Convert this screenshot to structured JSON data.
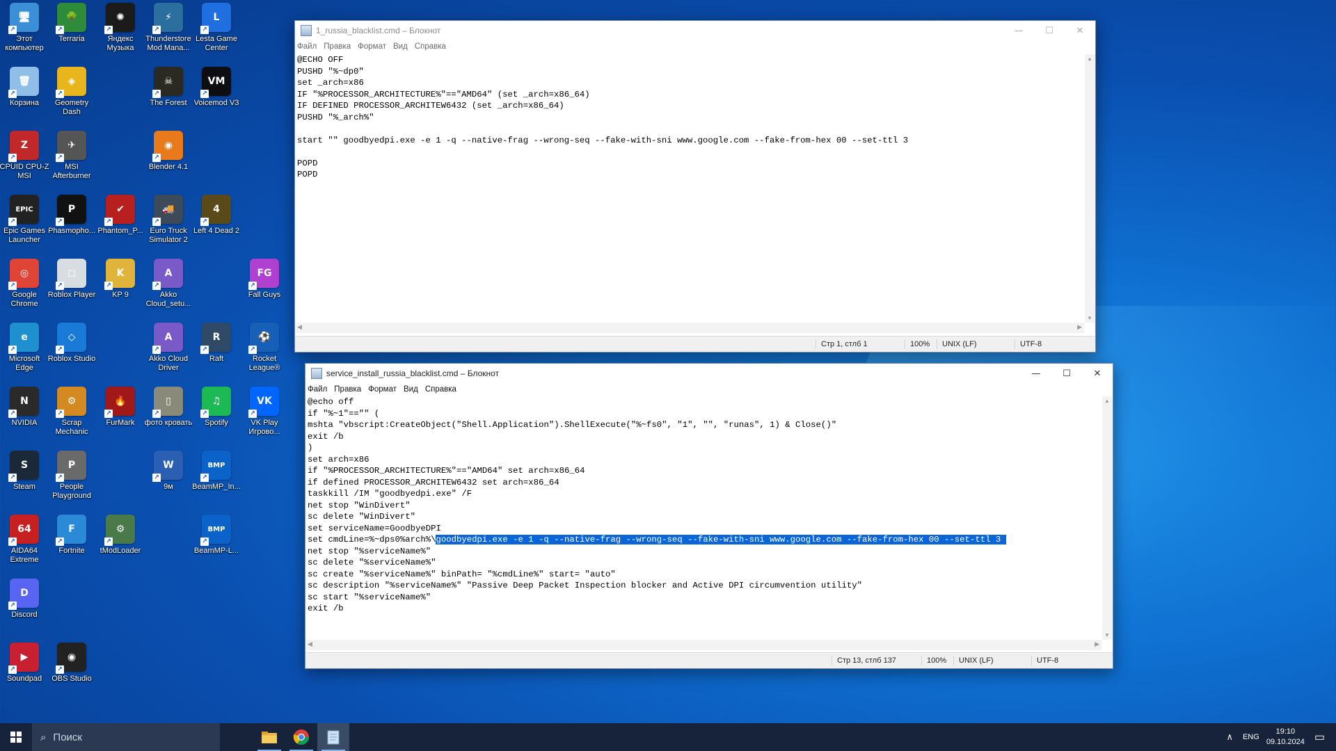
{
  "desktop": {
    "icons": [
      {
        "label": "Этот компьютер",
        "glyph": "🖥",
        "bg": "#3a8fd6"
      },
      {
        "label": "Terraria",
        "glyph": "🌳",
        "bg": "#2e8b3a"
      },
      {
        "label": "Яндекс Музыка",
        "glyph": "✺",
        "bg": "#1b1b1b"
      },
      {
        "label": "Thunderstore Mod Mana...",
        "glyph": "⚡",
        "bg": "#2b6f9e"
      },
      {
        "label": "Lesta Game Center",
        "glyph": "L",
        "bg": "#1f6fe0"
      },
      {
        "label": "Корзина",
        "glyph": "🗑",
        "bg": "#8fbfe8"
      },
      {
        "label": "Geometry Dash",
        "glyph": "◈",
        "bg": "#e8b51c"
      },
      {
        "label": "The Forest",
        "glyph": "☠",
        "bg": "#2a2a22"
      },
      {
        "label": "Voicemod V3",
        "glyph": "VM",
        "bg": "#0e0e12"
      },
      {
        "label": "CPUID CPU-Z MSI",
        "glyph": "Z",
        "bg": "#c0282a"
      },
      {
        "label": "MSI Afterburner",
        "glyph": "✈",
        "bg": "#555"
      },
      {
        "label": "Blender 4.1",
        "glyph": "◉",
        "bg": "#e87a1c"
      },
      {
        "label": "Epic Games Launcher",
        "glyph": "EPIC",
        "bg": "#222"
      },
      {
        "label": "Phasmopho...",
        "glyph": "P",
        "bg": "#111"
      },
      {
        "label": "Phantom_P...",
        "glyph": "✔",
        "bg": "#b82020"
      },
      {
        "label": "Euro Truck Simulator 2",
        "glyph": "🚚",
        "bg": "#3d4a5a"
      },
      {
        "label": "Left 4 Dead 2",
        "glyph": "4",
        "bg": "#5a4a1a"
      },
      {
        "label": "Google Chrome",
        "glyph": "◎",
        "bg": "#e04436"
      },
      {
        "label": "Roblox Player",
        "glyph": "◻",
        "bg": "#d8dde2"
      },
      {
        "label": "KP 9",
        "glyph": "K",
        "bg": "#e0b43a"
      },
      {
        "label": "Akko Cloud_setu...",
        "glyph": "A",
        "bg": "#7a5ac8"
      },
      {
        "label": "Fall Guys",
        "glyph": "FG",
        "bg": "#b040d0"
      },
      {
        "label": "Microsoft Edge",
        "glyph": "e",
        "bg": "#1e8fcf"
      },
      {
        "label": "Roblox Studio",
        "glyph": "◇",
        "bg": "#1a7ad8"
      },
      {
        "label": "Akko Cloud Driver",
        "glyph": "A",
        "bg": "#7a5ac8"
      },
      {
        "label": "Raft",
        "glyph": "R",
        "bg": "#2e4a66"
      },
      {
        "label": "Rocket League®",
        "glyph": "⚽",
        "bg": "#1660b8"
      },
      {
        "label": "NVIDIA",
        "glyph": "N",
        "bg": "#2a2a2a"
      },
      {
        "label": "Scrap Mechanic",
        "glyph": "⚙",
        "bg": "#d48a20"
      },
      {
        "label": "FurMark",
        "glyph": "🔥",
        "bg": "#a01818"
      },
      {
        "label": "фото кровать",
        "glyph": "▯",
        "bg": "#8a8a7a"
      },
      {
        "label": "Spotify",
        "glyph": "♫",
        "bg": "#1db954"
      },
      {
        "label": "VK Play Игрово...",
        "glyph": "VK",
        "bg": "#0066ff"
      },
      {
        "label": "Steam",
        "glyph": "S",
        "bg": "#1b2838"
      },
      {
        "label": "People Playground",
        "glyph": "P",
        "bg": "#6a6a6a"
      },
      {
        "label": "9м",
        "glyph": "W",
        "bg": "#2b5fb3"
      },
      {
        "label": "BeamMP_In...",
        "glyph": "BMP",
        "bg": "#0b63c9"
      },
      {
        "label": "AIDA64 Extreme",
        "glyph": "64",
        "bg": "#c82020"
      },
      {
        "label": "Fortnite",
        "glyph": "F",
        "bg": "#2a8ad8"
      },
      {
        "label": "tModLoader",
        "glyph": "⚙",
        "bg": "#4a7a4a"
      },
      {
        "label": "BeamMP-L...",
        "glyph": "BMP",
        "bg": "#0b63c9"
      },
      {
        "label": "Discord",
        "glyph": "D",
        "bg": "#5865f2"
      },
      {
        "label": "Soundpad",
        "glyph": "▶",
        "bg": "#c82030"
      },
      {
        "label": "OBS Studio",
        "glyph": "◉",
        "bg": "#222"
      }
    ]
  },
  "notepad1": {
    "title": "1_russia_blacklist.cmd – Блокнот",
    "menu": [
      "Файл",
      "Правка",
      "Формат",
      "Вид",
      "Справка"
    ],
    "lines": [
      "@ECHO OFF",
      "PUSHD \"%~dp0\"",
      "set _arch=x86",
      "IF \"%PROCESSOR_ARCHITECTURE%\"==\"AMD64\" (set _arch=x86_64)",
      "IF DEFINED PROCESSOR_ARCHITEW6432 (set _arch=x86_64)",
      "PUSHD \"%_arch%\"",
      "",
      "start \"\" goodbyedpi.exe -e 1 -q --native-frag --wrong-seq --fake-with-sni www.google.com --fake-from-hex 00 --set-ttl 3",
      "",
      "POPD",
      "POPD"
    ],
    "status": {
      "pos": "Стр 1, стлб 1",
      "zoom": "100%",
      "eol": "UNIX (LF)",
      "enc": "UTF-8"
    },
    "buttons": {
      "min": "—",
      "max": "☐",
      "close": "✕"
    }
  },
  "notepad2": {
    "title": "service_install_russia_blacklist.cmd – Блокнот",
    "menu": [
      "Файл",
      "Правка",
      "Формат",
      "Вид",
      "Справка"
    ],
    "lines": [
      "@echo off",
      "if \"%~1\"==\"\" (",
      "mshta \"vbscript:CreateObject(\"Shell.Application\").ShellExecute(\"%~fs0\", \"1\", \"\", \"runas\", 1) & Close()\"",
      "exit /b",
      ")",
      "set arch=x86",
      "if \"%PROCESSOR_ARCHITECTURE%\"==\"AMD64\" set arch=x86_64",
      "if defined PROCESSOR_ARCHITEW6432 set arch=x86_64",
      "taskkill /IM \"goodbyedpi.exe\" /F",
      "net stop \"WinDivert\"",
      "sc delete \"WinDivert\"",
      "set serviceName=GoodbyeDPI",
      "",
      "net stop \"%serviceName%\"",
      "sc delete \"%serviceName%\"",
      "sc create \"%serviceName%\" binPath= \"%cmdLine%\" start= \"auto\"",
      "sc description \"%serviceName%\" \"Passive Deep Packet Inspection blocker and Active DPI circumvention utility\"",
      "sc start \"%serviceName%\"",
      "exit /b"
    ],
    "sel_prefix": "set cmdLine=%~dps0%arch%\\",
    "sel_text": "goodbyedpi.exe -e 1 -q --native-frag --wrong-seq --fake-with-sni www.google.com --fake-from-hex 00 --set-ttl 3 ",
    "status": {
      "pos": "Стр 13, стлб 137",
      "zoom": "100%",
      "eol": "UNIX (LF)",
      "enc": "UTF-8"
    },
    "buttons": {
      "min": "—",
      "max": "☐",
      "close": "✕"
    }
  },
  "taskbar": {
    "search_placeholder": "Поиск",
    "lang": "ENG",
    "time": "19:10",
    "date": "09.10.2024",
    "tray_chevron": "∧",
    "notif": "▭"
  }
}
